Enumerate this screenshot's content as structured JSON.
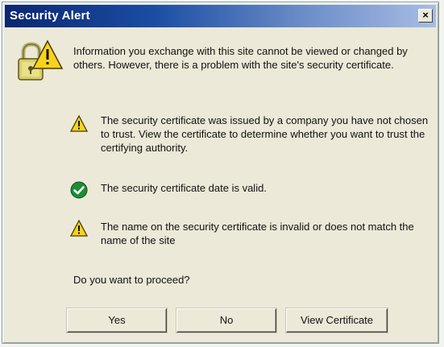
{
  "window": {
    "title": "Security Alert",
    "close_label": "×"
  },
  "intro": {
    "text": "Information you exchange with this site cannot be viewed or changed by others. However, there is a problem with the site's security certificate."
  },
  "items": [
    {
      "icon": "warning-icon",
      "text": "The security certificate was issued by a company you have not chosen to trust. View the certificate to determine whether you want to trust the certifying authority."
    },
    {
      "icon": "check-icon",
      "text": "The security certificate date is valid."
    },
    {
      "icon": "warning-icon",
      "text": "The name on the security certificate is invalid or does not match the name of the site"
    }
  ],
  "question": "Do you want to proceed?",
  "buttons": {
    "yes": "Yes",
    "no": "No",
    "view_certificate": "View Certificate"
  },
  "colors": {
    "title_bar": "#0a2672",
    "warning": "#f7d21f",
    "ok": "#1e8c36",
    "dialog_bg": "#ece9d8"
  }
}
